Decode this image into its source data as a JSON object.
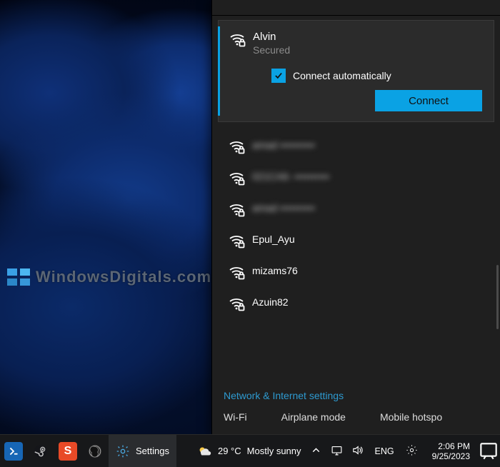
{
  "watermark": {
    "text": "WindowsDigitals.com"
  },
  "flyout": {
    "selected": {
      "ssid": "Alvin",
      "status": "Secured",
      "auto_connect_label": "Connect automatically",
      "auto_connect_checked": true,
      "connect_label": "Connect"
    },
    "networks": [
      {
        "ssid": "amad",
        "blurred": true
      },
      {
        "ssid": "021CA6-",
        "blurred": true
      },
      {
        "ssid": "amad",
        "blurred": true
      },
      {
        "ssid": "Epul_Ayu",
        "blurred": false
      },
      {
        "ssid": "mizams76",
        "blurred": false
      },
      {
        "ssid": "Azuin82",
        "blurred": false
      }
    ],
    "settings_link": "Network & Internet settings",
    "quick": {
      "wifi": "Wi-Fi",
      "airplane": "Airplane mode",
      "hotspot": "Mobile hotspo"
    }
  },
  "taskbar": {
    "settings_label": "Settings",
    "weather": {
      "temp": "29 °C",
      "text": "Mostly sunny"
    },
    "lang": "ENG",
    "time": "2:06 PM",
    "date": "9/25/2023"
  }
}
